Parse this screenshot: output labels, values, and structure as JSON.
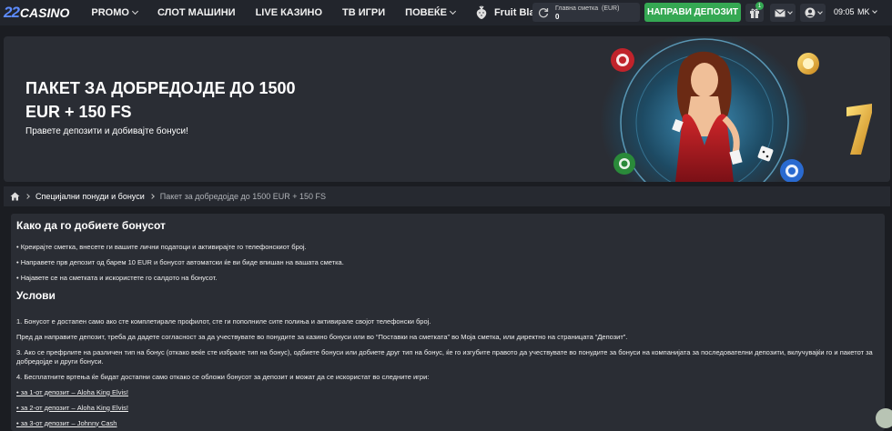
{
  "header": {
    "logo_num": "22",
    "logo_word": "CASINO",
    "nav": [
      {
        "label": "PROMO",
        "has_dropdown": true
      },
      {
        "label": "СЛОТ МАШИНИ",
        "has_dropdown": false
      },
      {
        "label": "LIVE КАЗИНО",
        "has_dropdown": false
      },
      {
        "label": "ТВ ИГРИ",
        "has_dropdown": false
      },
      {
        "label": "ПОВЕЌЕ",
        "has_dropdown": true
      }
    ],
    "fruit_blast": "Fruit Blast",
    "account_label": "Главна сметка",
    "account_currency": "(EUR)",
    "account_balance": "0",
    "deposit_button": "НАПРАВИ ДЕПОЗИТ",
    "gift_badge": "1",
    "time": "09:05",
    "language": "MK",
    "accent_green": "#35a853"
  },
  "banner": {
    "title": "ПАКЕТ ЗА ДОБРЕДОЈДЕ ДО 1500 EUR + 150 FS",
    "subtitle": "Правете депозити и добивајте бонуси!"
  },
  "breadcrumb": {
    "items": [
      "Специјални понуди и бонуси",
      "Пакет за добредојде до 1500 EUR + 150 FS"
    ]
  },
  "content": {
    "heading1": "Како да го добиете бонусот",
    "steps": [
      "• Креирајте сметка, внесете ги вашите лични податоци и активирајте го телефонскиот број.",
      "• Направете прв депозит од барем 10 EUR и бонусот автоматски ќе ви биде впишан на вашата сметка.",
      "• Најавете се на сметката и искористете го салдото на бонусот."
    ],
    "heading2": "Услови",
    "conditions": [
      "1. Бонусот е достапен само ако сте комплетирале профилот, сте ги пополниле сите полиња и активирале својот телефонски број.",
      "Пред да направите депозит, треба да дадете согласност за да учествувате во понудите за казино бонуси или во “Поставки на сметката” во Моја сметка, или директно на страницата “Депозит”.",
      "3. Ако се префрлите на различен тип на бонус (откако веќе сте избрале тип на бонус), одбиете бонуси или добиете друг тип на бонус, ќе го изгубите правото да учествувате во понудите за бонуси на компанијата за последователни депозити, вклучувајќи го и пакетот за добредојде и други бонуси.",
      "4. Бесплатните вртења ќе бидат достапни само откако се обложи бонусот за депозит и можат да се искористат во следните игри:"
    ],
    "games": [
      "• за 1-от депозит – Aloha King Elvis!",
      "• за 2-от депозит – Aloha King Elvis!",
      "• за 3-от депозит – Johnny Cash"
    ]
  }
}
